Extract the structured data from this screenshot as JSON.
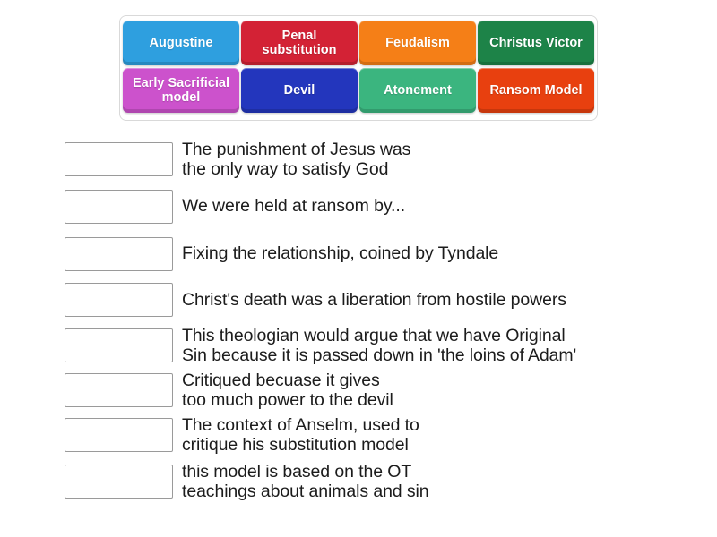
{
  "activity": {
    "type": "match-up",
    "tray": {
      "tiles": [
        {
          "label": "Augustine",
          "color": "#2e9fdf",
          "name": "tile-augustine"
        },
        {
          "label": "Penal\nsubstitution",
          "color": "#d32235",
          "name": "tile-penal-substitution"
        },
        {
          "label": "Feudalism",
          "color": "#f57f17",
          "name": "tile-feudalism"
        },
        {
          "label": "Christus Victor",
          "color": "#1d8348",
          "name": "tile-christus-victor"
        },
        {
          "label": "Early Sacrificial\nmodel",
          "color": "#cc52cc",
          "name": "tile-early-sacrificial-model"
        },
        {
          "label": "Devil",
          "color": "#2336bd",
          "name": "tile-devil"
        },
        {
          "label": "Atonement",
          "color": "#3bb57f",
          "name": "tile-atonement"
        },
        {
          "label": "Ransom Model",
          "color": "#e8400f",
          "name": "tile-ransom-model"
        }
      ]
    },
    "rows": [
      {
        "prompt": "The punishment of Jesus was\nthe only way to satisfy God",
        "answer": ""
      },
      {
        "prompt": "We were held at ransom by...",
        "answer": ""
      },
      {
        "prompt": "Fixing the relationship, coined by Tyndale",
        "answer": ""
      },
      {
        "prompt": "Christ's death was a liberation from hostile powers",
        "answer": ""
      },
      {
        "prompt": "This theologian would argue that we have Original\nSin because it is passed down in 'the loins of Adam'",
        "answer": ""
      },
      {
        "prompt": "Critiqued becuase it gives\ntoo much power to the devil",
        "answer": ""
      },
      {
        "prompt": "The context of Anselm, used to\ncritique his substitution model",
        "answer": ""
      },
      {
        "prompt": "this model is based on the OT\nteachings about animals and sin",
        "answer": ""
      }
    ]
  }
}
